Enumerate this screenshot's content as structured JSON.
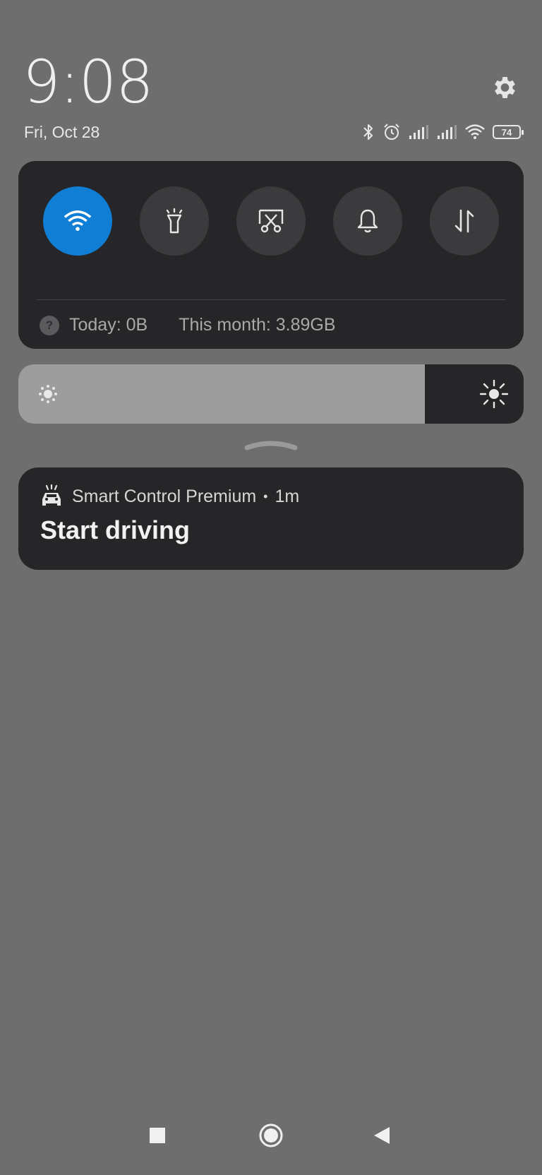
{
  "status": {
    "time": "9:08",
    "date": "Fri, Oct 28",
    "battery": "74",
    "icons": [
      "bluetooth-icon",
      "alarm-icon",
      "signal-icon",
      "signal-icon",
      "wifi-icon",
      "battery-icon"
    ]
  },
  "quick_settings": {
    "tiles": [
      {
        "name": "wifi",
        "active": true
      },
      {
        "name": "flashlight",
        "active": false
      },
      {
        "name": "screenshot",
        "active": false
      },
      {
        "name": "silent",
        "active": false
      },
      {
        "name": "mobile-data",
        "active": false
      }
    ],
    "data_today": "Today: 0B",
    "data_month": "This month: 3.89GB"
  },
  "brightness": {
    "level": 0.805
  },
  "notification": {
    "app": "Smart Control Premium",
    "separator": "•",
    "age": "1m",
    "title": "Start driving"
  },
  "colors": {
    "background": "#6e6e6e",
    "panel": "#262628",
    "accent": "#0f7ed4",
    "tile": "#3b3b3d"
  }
}
